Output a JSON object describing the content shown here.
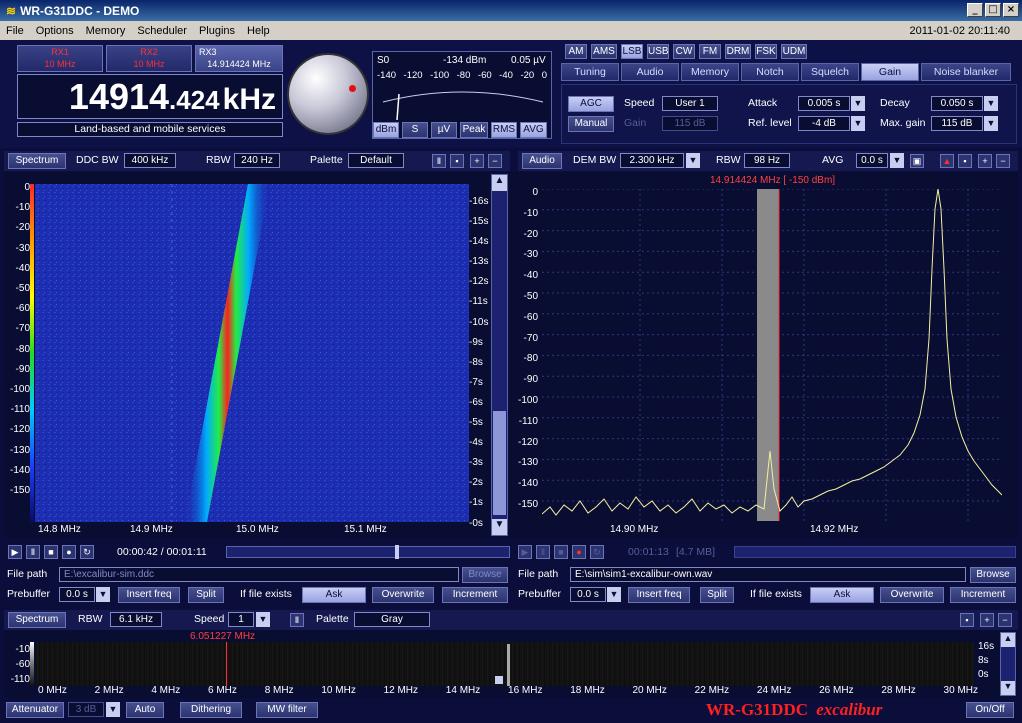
{
  "window": {
    "title": "WR-G31DDC - DEMO",
    "logo": "≋"
  },
  "menu": {
    "items": [
      "File",
      "Options",
      "Memory",
      "Scheduler",
      "Plugins",
      "Help"
    ],
    "clock": "2011-01-02 20:11:40"
  },
  "receivers": [
    {
      "name": "RX1",
      "freq": "10 MHz"
    },
    {
      "name": "RX2",
      "freq": "10 MHz"
    },
    {
      "name": "RX3",
      "freq": "14.914424 MHz"
    }
  ],
  "frequency": {
    "main": "14914",
    "frac": ".424",
    "unit": "kHz",
    "band": "Land-based and mobile services"
  },
  "smeter": {
    "s": "S0",
    "dbm": "-134 dBm",
    "uv": "0.05 µV",
    "scale": [
      "-140",
      "-120",
      "-100",
      "-80",
      "-60",
      "-40",
      "-20",
      "0"
    ],
    "buttons": [
      "dBm",
      "S",
      "µV",
      "Peak",
      "RMS",
      "AVG"
    ],
    "selected": [
      "dBm",
      "RMS",
      "AVG"
    ]
  },
  "modes": {
    "items": [
      "AM",
      "AMS",
      "LSB",
      "USB",
      "CW",
      "FM",
      "DRM",
      "FSK",
      "UDM"
    ],
    "selected": "LSB"
  },
  "tabs": {
    "items": [
      "Tuning",
      "Audio",
      "Memory",
      "Notch",
      "Squelch",
      "Gain",
      "Noise blanker"
    ],
    "selected": "Gain"
  },
  "gain": {
    "agc": "AGC",
    "manual": "Manual",
    "gain_label": "Gain",
    "gain_value": "115 dB",
    "speed_label": "Speed",
    "speed_value": "User 1",
    "attack_label": "Attack",
    "attack_value": "0.005 s",
    "ref_label": "Ref. level",
    "ref_value": "-4 dB",
    "decay_label": "Decay",
    "decay_value": "0.050 s",
    "maxgain_label": "Max. gain",
    "maxgain_value": "115 dB"
  },
  "spectrum": {
    "title": "Spectrum",
    "ddcbw_label": "DDC BW",
    "ddcbw": "400 kHz",
    "rbw_label": "RBW",
    "rbw": "240 Hz",
    "palette_label": "Palette",
    "palette": "Default",
    "yticks": [
      "0",
      "-10",
      "-20",
      "-30",
      "-40",
      "-50",
      "-60",
      "-70",
      "-80",
      "-90",
      "-100",
      "-110",
      "-120",
      "-130",
      "-140",
      "-150"
    ],
    "xticks": [
      "14.8 MHz",
      "14.9 MHz",
      "15.0 MHz",
      "15.1 MHz"
    ],
    "timeticks": [
      "-16s",
      "-15s",
      "-14s",
      "-13s",
      "-12s",
      "-11s",
      "-10s",
      "-9s",
      "-8s",
      "-7s",
      "-6s",
      "-5s",
      "-4s",
      "-3s",
      "-2s",
      "-1s",
      "-0s"
    ]
  },
  "audio": {
    "title": "Audio",
    "dembw_label": "DEM BW",
    "dembw": "2.300 kHz",
    "rbw_label": "RBW",
    "rbw": "98 Hz",
    "avg_label": "AVG",
    "avg": "0.0 s",
    "marker": "14.914424 MHz [ -150 dBm]",
    "yticks": [
      "0",
      "-10",
      "-20",
      "-30",
      "-40",
      "-50",
      "-60",
      "-70",
      "-80",
      "-90",
      "-100",
      "-110",
      "-120",
      "-130",
      "-140",
      "-150"
    ],
    "xticks": [
      "14.90 MHz",
      "14.92 MHz"
    ]
  },
  "player_left": {
    "time": "00:00:42 / 00:01:11",
    "filepath_label": "File path",
    "filepath": "E:\\excalibur-sim.ddc",
    "browse": "Browse",
    "prebuffer_label": "Prebuffer",
    "prebuffer": "0.0 s",
    "insert": "Insert freq",
    "split": "Split",
    "ifexists": "If file exists",
    "ask": "Ask",
    "overwrite": "Overwrite",
    "increment": "Increment"
  },
  "player_right": {
    "time": "00:01:13",
    "size": "[4.7 MB]",
    "filepath_label": "File path",
    "filepath": "E:\\sim\\sim1-excalibur-own.wav",
    "browse": "Browse",
    "prebuffer_label": "Prebuffer",
    "prebuffer": "0.0 s",
    "insert": "Insert freq",
    "split": "Split",
    "ifexists": "If file exists",
    "ask": "Ask",
    "overwrite": "Overwrite",
    "increment": "Increment"
  },
  "wideband": {
    "title": "Spectrum",
    "rbw_label": "RBW",
    "rbw": "6.1 kHz",
    "speed_label": "Speed",
    "speed": "1",
    "palette_label": "Palette",
    "palette": "Gray",
    "marker": "6.051227 MHz",
    "yticks": [
      "-10",
      "-60",
      "-110"
    ],
    "xticks": [
      "0 MHz",
      "2 MHz",
      "4 MHz",
      "6 MHz",
      "8 MHz",
      "10 MHz",
      "12 MHz",
      "14 MHz",
      "16 MHz",
      "18 MHz",
      "20 MHz",
      "22 MHz",
      "24 MHz",
      "26 MHz",
      "28 MHz",
      "30 MHz"
    ],
    "timeticks": [
      "16s",
      "8s",
      "0s"
    ]
  },
  "bottom": {
    "attenuator": "Attenuator",
    "att_value": "3 dB",
    "auto": "Auto",
    "dithering": "Dithering",
    "mwfilter": "MW filter",
    "brand": "WR-G31DDC",
    "brand2": "excalibur",
    "onoff": "On/Off"
  },
  "colors": {
    "bg": "#0b0e3a",
    "accent": "#ff2020",
    "trace": "#f4f0a0"
  }
}
